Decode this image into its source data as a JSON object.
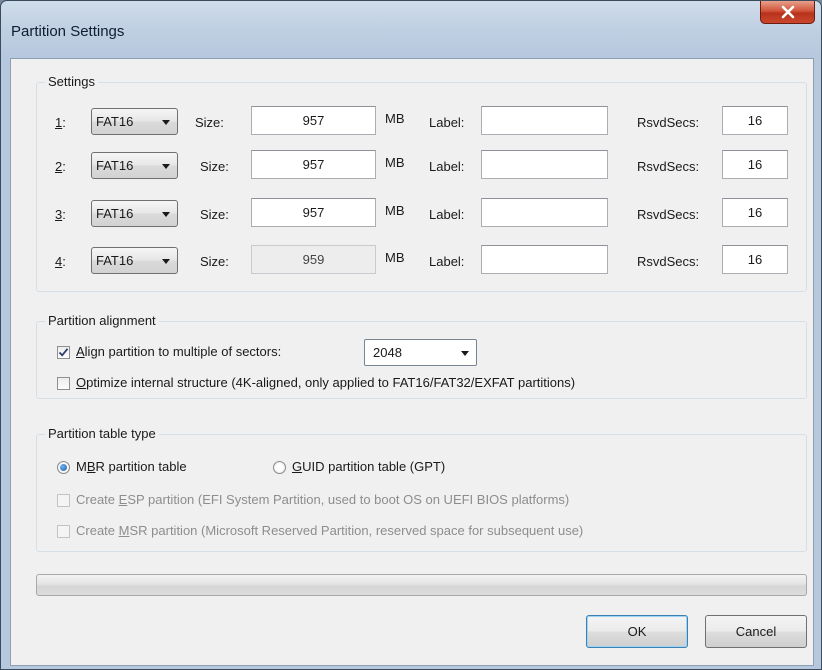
{
  "window": {
    "title": "Partition Settings"
  },
  "settings": {
    "legend": "Settings",
    "size_label": "Size:",
    "unit": "MB",
    "label_label": "Label:",
    "rsvd_label": "RsvdSecs:",
    "rows": [
      {
        "index": "1",
        "fs": "FAT16",
        "size": "957",
        "label": "",
        "rsvd": "16",
        "size_disabled": false
      },
      {
        "index": "2",
        "fs": "FAT16",
        "size": "957",
        "label": "",
        "rsvd": "16",
        "size_disabled": false
      },
      {
        "index": "3",
        "fs": "FAT16",
        "size": "957",
        "label": "",
        "rsvd": "16",
        "size_disabled": false
      },
      {
        "index": "4",
        "fs": "FAT16",
        "size": "959",
        "label": "",
        "rsvd": "16",
        "size_disabled": true
      }
    ]
  },
  "alignment": {
    "legend": "Partition alignment",
    "align_checked": true,
    "align_label_first": "A",
    "align_label_rest": "lign partition to multiple of sectors:",
    "sectors_value": "2048",
    "optimize_checked": false,
    "optimize_label_first": "O",
    "optimize_label_rest": "ptimize internal structure (4K-aligned, only applied to FAT16/FAT32/EXFAT partitions)"
  },
  "table_type": {
    "legend": "Partition table type",
    "mbr_selected": true,
    "mbr_prefix": "M",
    "mbr_underlined": "B",
    "mbr_rest": "R partition table",
    "gpt_prefix": "",
    "gpt_underlined": "G",
    "gpt_rest": "UID partition table (GPT)",
    "esp_enabled": false,
    "esp_prefix": "Create ",
    "esp_underlined": "E",
    "esp_rest": "SP partition (EFI System Partition, used to boot OS on UEFI BIOS platforms)",
    "msr_enabled": false,
    "msr_prefix": "Create ",
    "msr_underlined": "M",
    "msr_rest": "SR partition (Microsoft Reserved Partition, reserved space for subsequent use)"
  },
  "progress": {
    "value": 0
  },
  "buttons": {
    "ok": "OK",
    "cancel": "Cancel"
  },
  "colors": {
    "accent": "#1c5fa8",
    "close": "#c9482c"
  }
}
